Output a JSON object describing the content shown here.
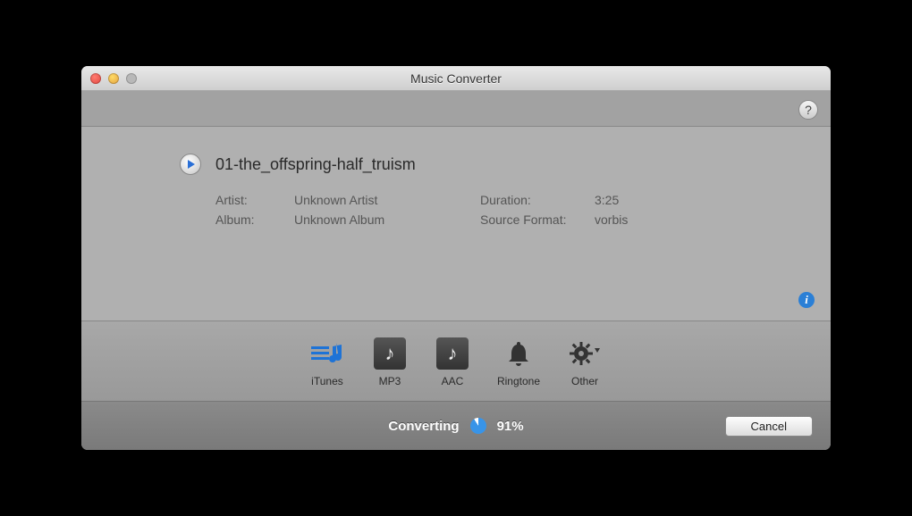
{
  "window": {
    "title": "Music Converter"
  },
  "track": {
    "filename": "01-the_offspring-half_truism",
    "artist_label": "Artist:",
    "artist": "Unknown Artist",
    "album_label": "Album:",
    "album": "Unknown Album",
    "duration_label": "Duration:",
    "duration": "3:25",
    "format_label": "Source Format:",
    "format": "vorbis"
  },
  "formats": {
    "itunes": "iTunes",
    "mp3": "MP3",
    "aac": "AAC",
    "ringtone": "Ringtone",
    "other": "Other"
  },
  "status": {
    "label": "Converting",
    "percent": "91%"
  },
  "buttons": {
    "cancel": "Cancel"
  }
}
